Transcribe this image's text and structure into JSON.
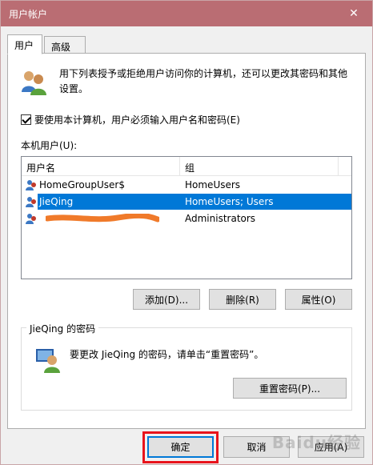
{
  "window": {
    "title": "用户帐户",
    "close_glyph": "✕"
  },
  "tabs": [
    {
      "label": "用户",
      "active": true
    },
    {
      "label": "高级",
      "active": false
    }
  ],
  "intro": {
    "text": "用下列表授予或拒绝用户访问你的计算机，还可以更改其密码和其他设置。",
    "icon": "users-icon"
  },
  "require_login": {
    "label": "要使用本计算机，用户必须输入用户名和密码(E)",
    "checked": true
  },
  "user_list": {
    "label": "本机用户(U):",
    "columns": [
      "用户名",
      "组"
    ],
    "rows": [
      {
        "name": "HomeGroupUser$",
        "group": "HomeUsers",
        "selected": false
      },
      {
        "name": "JieQing",
        "group": "HomeUsers; Users",
        "selected": true
      },
      {
        "name": "",
        "group": "Administrators",
        "selected": false,
        "redacted": true
      }
    ]
  },
  "list_buttons": {
    "add": "添加(D)...",
    "remove": "删除(R)",
    "properties": "属性(O)"
  },
  "password_group": {
    "title": "JieQing 的密码",
    "text": "要更改 JieQing 的密码，请单击“重置密码”。",
    "reset_button": "重置密码(P)...",
    "icon": "user-password-icon"
  },
  "footer": {
    "ok": "确定",
    "cancel": "取消",
    "apply": "应用(A)"
  },
  "watermark": "Baidu经验",
  "colors": {
    "titlebar": "#ba6d73",
    "selection": "#0078d7",
    "highlight": "#e8141c",
    "scribble": "#f07a2a"
  }
}
